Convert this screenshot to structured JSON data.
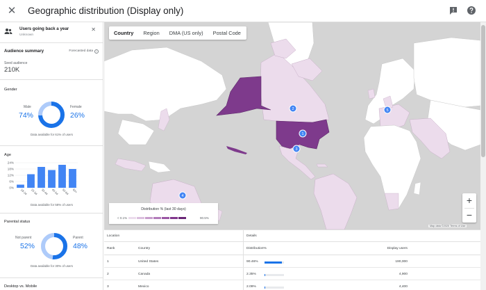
{
  "header": {
    "title": "Geographic distribution (Display only)"
  },
  "segment": {
    "title": "Users going back a year",
    "subtitle": "Unknown"
  },
  "summary": {
    "title": "Audience summary",
    "forecast_note": "Forecasted data",
    "seed_label": "Seed audience",
    "seed_value": "210K"
  },
  "gender": {
    "title": "Gender",
    "male_label": "Male",
    "male_pct": "74%",
    "male_share": 0.74,
    "female_label": "Female",
    "female_pct": "26%",
    "female_share": 0.26,
    "availability": "Data available for 61% of users"
  },
  "age": {
    "title": "Age",
    "y_ticks": [
      "24%",
      "18%",
      "12%",
      "6%",
      "0%"
    ],
    "ylim": [
      0,
      24
    ],
    "categories": [
      "18-24",
      "25-34",
      "35-44",
      "45-54",
      "55-64",
      "65+"
    ],
    "values": [
      3,
      13,
      20,
      17,
      22,
      18
    ],
    "availability": "Data available for 58% of users"
  },
  "parental": {
    "title": "Parental status",
    "not_parent_label": "Not parent",
    "not_parent_pct": "52%",
    "not_parent_share": 0.52,
    "parent_label": "Parent",
    "parent_pct": "48%",
    "parent_share": 0.48,
    "availability": "Data available for 30% of users"
  },
  "desktop": {
    "title": "Desktop vs. Mobile"
  },
  "map": {
    "tabs": [
      "Country",
      "Region",
      "DMA (US only)",
      "Postal Code"
    ],
    "active_tab": "Country",
    "markers": [
      "1",
      "2",
      "3",
      "4",
      "5"
    ],
    "legend_title": "Distribution % (last 30 days)",
    "legend_min": "< 0.1%",
    "legend_max": "90.5%",
    "legend_colors": [
      "#ebdcec",
      "#dbbfde",
      "#c79dcc",
      "#b27bba",
      "#9a55a4",
      "#81378d",
      "#6a2677"
    ],
    "zoom_in": "+",
    "zoom_out": "−",
    "attribution": "Map data ©2020  Terms of Use"
  },
  "table": {
    "group_location": "Location",
    "group_details": "Details",
    "columns": {
      "rank": "Rank",
      "country": "Country",
      "distribution": "Distribution%",
      "users": "Display users"
    },
    "rows": [
      {
        "rank": "1",
        "country": "United States",
        "distribution": "90.46%",
        "share": 0.9046,
        "users": "190,000"
      },
      {
        "rank": "2",
        "country": "Canada",
        "distribution": "2.35%",
        "share": 0.0235,
        "users": "4,900"
      },
      {
        "rank": "3",
        "country": "Mexico",
        "distribution": "2.09%",
        "share": 0.0209,
        "users": "4,400"
      }
    ]
  }
}
